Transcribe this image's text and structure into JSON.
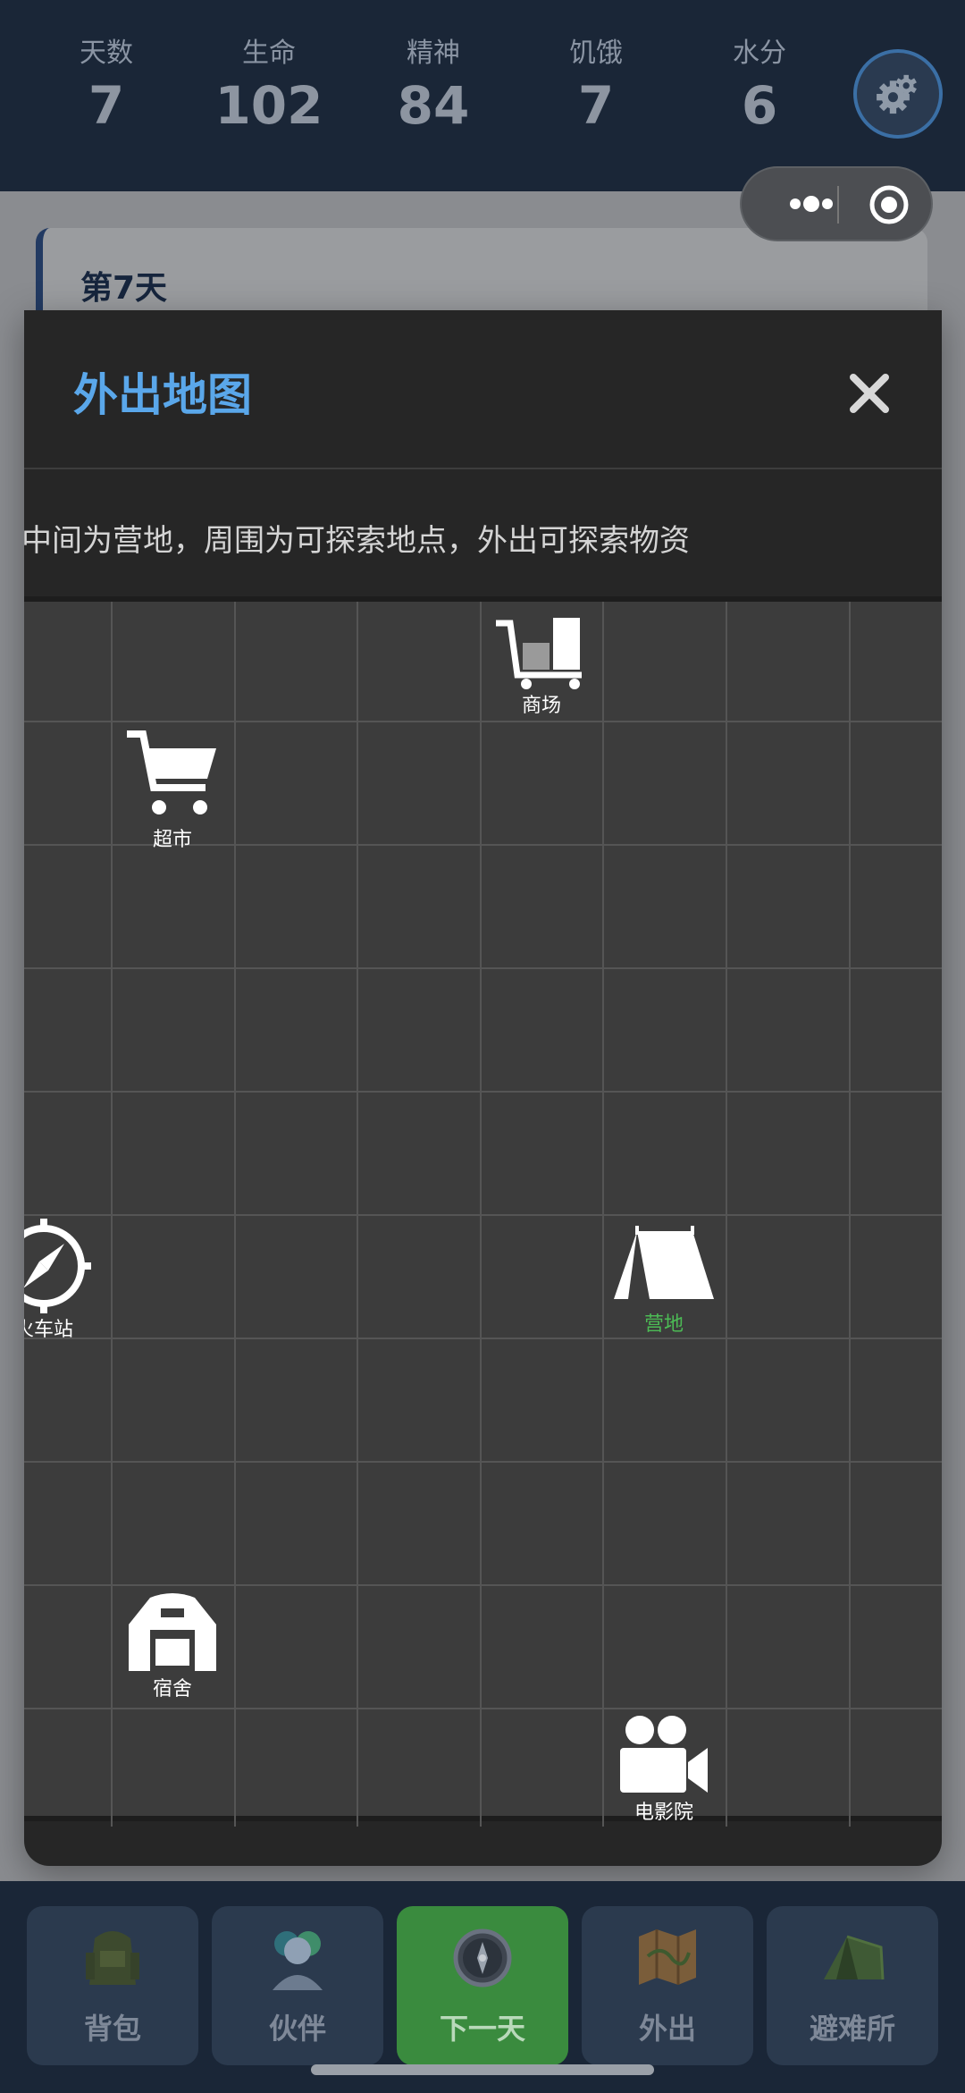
{
  "stats": [
    {
      "label": "天数",
      "value": "7"
    },
    {
      "label": "生命",
      "value": "102"
    },
    {
      "label": "精神",
      "value": "84"
    },
    {
      "label": "饥饿",
      "value": "7"
    },
    {
      "label": "水分",
      "value": "6"
    }
  ],
  "day_card": {
    "title": "第7天"
  },
  "modal": {
    "title": "外出地图",
    "subtitle": "中间为营地，周围为可探索地点，外出可探索物资",
    "locations": {
      "mall": "商场",
      "supermarket": "超市",
      "train_station": "火车站",
      "camp": "营地",
      "dorm": "宿舍",
      "cinema": "电影院"
    }
  },
  "nav": {
    "backpack": "背包",
    "partner": "伙伴",
    "next_day": "下一天",
    "go_out": "外出",
    "shelter": "避难所"
  },
  "colors": {
    "accent_blue": "#5aa7ea",
    "camp_green": "#4cbb55",
    "active_nav": "#3a8b3e"
  }
}
